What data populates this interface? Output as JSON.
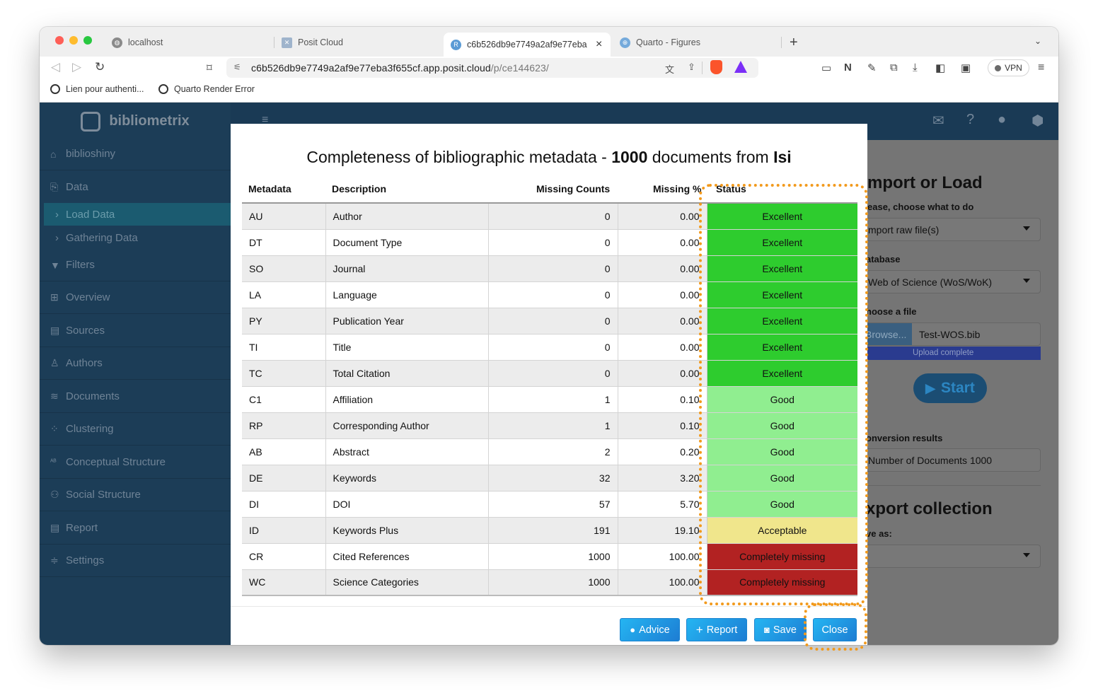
{
  "browser": {
    "tabs": [
      {
        "label": "localhost"
      },
      {
        "label": "Posit Cloud"
      },
      {
        "label": "c6b526db9e7749a2af9e77eba"
      },
      {
        "label": "Quarto - Figures"
      }
    ],
    "active_tab_close": "×",
    "new_tab": "+",
    "url_host": "c6b526db9e7749a2af9e77eba3f655cf.app.posit.cloud",
    "url_path": "/p/ce144623/",
    "vpn_label": "VPN",
    "bookmarks": [
      {
        "label": "Lien pour authenti..."
      },
      {
        "label": "Quarto Render Error"
      }
    ]
  },
  "app": {
    "brand": "bibliometrix",
    "sidebar": {
      "items": [
        {
          "label": "biblioshiny",
          "icon": "home-icon"
        },
        {
          "label": "Data",
          "icon": "file-import-icon"
        },
        {
          "label": "Filters",
          "icon": "filter-icon"
        },
        {
          "label": "Overview",
          "icon": "table-icon"
        },
        {
          "label": "Sources",
          "icon": "book-icon"
        },
        {
          "label": "Authors",
          "icon": "user-icon"
        },
        {
          "label": "Documents",
          "icon": "layers-icon"
        },
        {
          "label": "Clustering",
          "icon": "spinner-icon"
        },
        {
          "label": "Conceptual Structure",
          "icon": "spellcheck-icon"
        },
        {
          "label": "Social Structure",
          "icon": "users-icon"
        },
        {
          "label": "Report",
          "icon": "list-icon"
        },
        {
          "label": "Settings",
          "icon": "sliders-icon"
        }
      ],
      "subitems": [
        {
          "label": "Load Data"
        },
        {
          "label": "Gathering Data"
        }
      ]
    },
    "panel": {
      "import_heading": "mport or Load",
      "choose_label": "ease, choose what to do",
      "choose_value": "mport raw file(s)",
      "database_label": "atabase",
      "database_value": "Web of Science (WoS/WoK)",
      "file_label": "hoose a file",
      "browse_label": "Browse...",
      "file_name": "Test-WOS.bib",
      "upload_status": "Upload complete",
      "start_label": "Start",
      "conversion_label": "onversion results",
      "conversion_value": "Number of Documents  1000",
      "export_heading": "xport collection",
      "save_as_label": "ve as:"
    }
  },
  "modal": {
    "title_prefix": "Completeness of bibliographic metadata - ",
    "title_count": "1000",
    "title_middle": " documents from ",
    "title_source": "Isi",
    "columns": {
      "metadata": "Metadata",
      "description": "Description",
      "missing_counts": "Missing Counts",
      "missing_pct": "Missing %",
      "status": "Status"
    },
    "rows": [
      {
        "metadata": "AU",
        "description": "Author",
        "missing_counts": "0",
        "missing_pct": "0.00",
        "status": "Excellent"
      },
      {
        "metadata": "DT",
        "description": "Document Type",
        "missing_counts": "0",
        "missing_pct": "0.00",
        "status": "Excellent"
      },
      {
        "metadata": "SO",
        "description": "Journal",
        "missing_counts": "0",
        "missing_pct": "0.00",
        "status": "Excellent"
      },
      {
        "metadata": "LA",
        "description": "Language",
        "missing_counts": "0",
        "missing_pct": "0.00",
        "status": "Excellent"
      },
      {
        "metadata": "PY",
        "description": "Publication Year",
        "missing_counts": "0",
        "missing_pct": "0.00",
        "status": "Excellent"
      },
      {
        "metadata": "TI",
        "description": "Title",
        "missing_counts": "0",
        "missing_pct": "0.00",
        "status": "Excellent"
      },
      {
        "metadata": "TC",
        "description": "Total Citation",
        "missing_counts": "0",
        "missing_pct": "0.00",
        "status": "Excellent"
      },
      {
        "metadata": "C1",
        "description": "Affiliation",
        "missing_counts": "1",
        "missing_pct": "0.10",
        "status": "Good"
      },
      {
        "metadata": "RP",
        "description": "Corresponding Author",
        "missing_counts": "1",
        "missing_pct": "0.10",
        "status": "Good"
      },
      {
        "metadata": "AB",
        "description": "Abstract",
        "missing_counts": "2",
        "missing_pct": "0.20",
        "status": "Good"
      },
      {
        "metadata": "DE",
        "description": "Keywords",
        "missing_counts": "32",
        "missing_pct": "3.20",
        "status": "Good"
      },
      {
        "metadata": "DI",
        "description": "DOI",
        "missing_counts": "57",
        "missing_pct": "5.70",
        "status": "Good"
      },
      {
        "metadata": "ID",
        "description": "Keywords Plus",
        "missing_counts": "191",
        "missing_pct": "19.10",
        "status": "Acceptable"
      },
      {
        "metadata": "CR",
        "description": "Cited References",
        "missing_counts": "1000",
        "missing_pct": "100.00",
        "status": "Completely missing"
      },
      {
        "metadata": "WC",
        "description": "Science Categories",
        "missing_counts": "1000",
        "missing_pct": "100.00",
        "status": "Completely missing"
      }
    ],
    "status_colors": {
      "Excellent": "#2ecc2e",
      "Good": "#90ee90",
      "Acceptable": "#f0e68c",
      "Completely missing": "#b22222"
    },
    "buttons": {
      "advice": "Advice",
      "report": "Report",
      "save": "Save",
      "close": "Close"
    }
  },
  "colors": {
    "highlight": "#f29a1d",
    "sidebar_bg": "#1c3d57",
    "button_blue": "#1d8ee0"
  }
}
